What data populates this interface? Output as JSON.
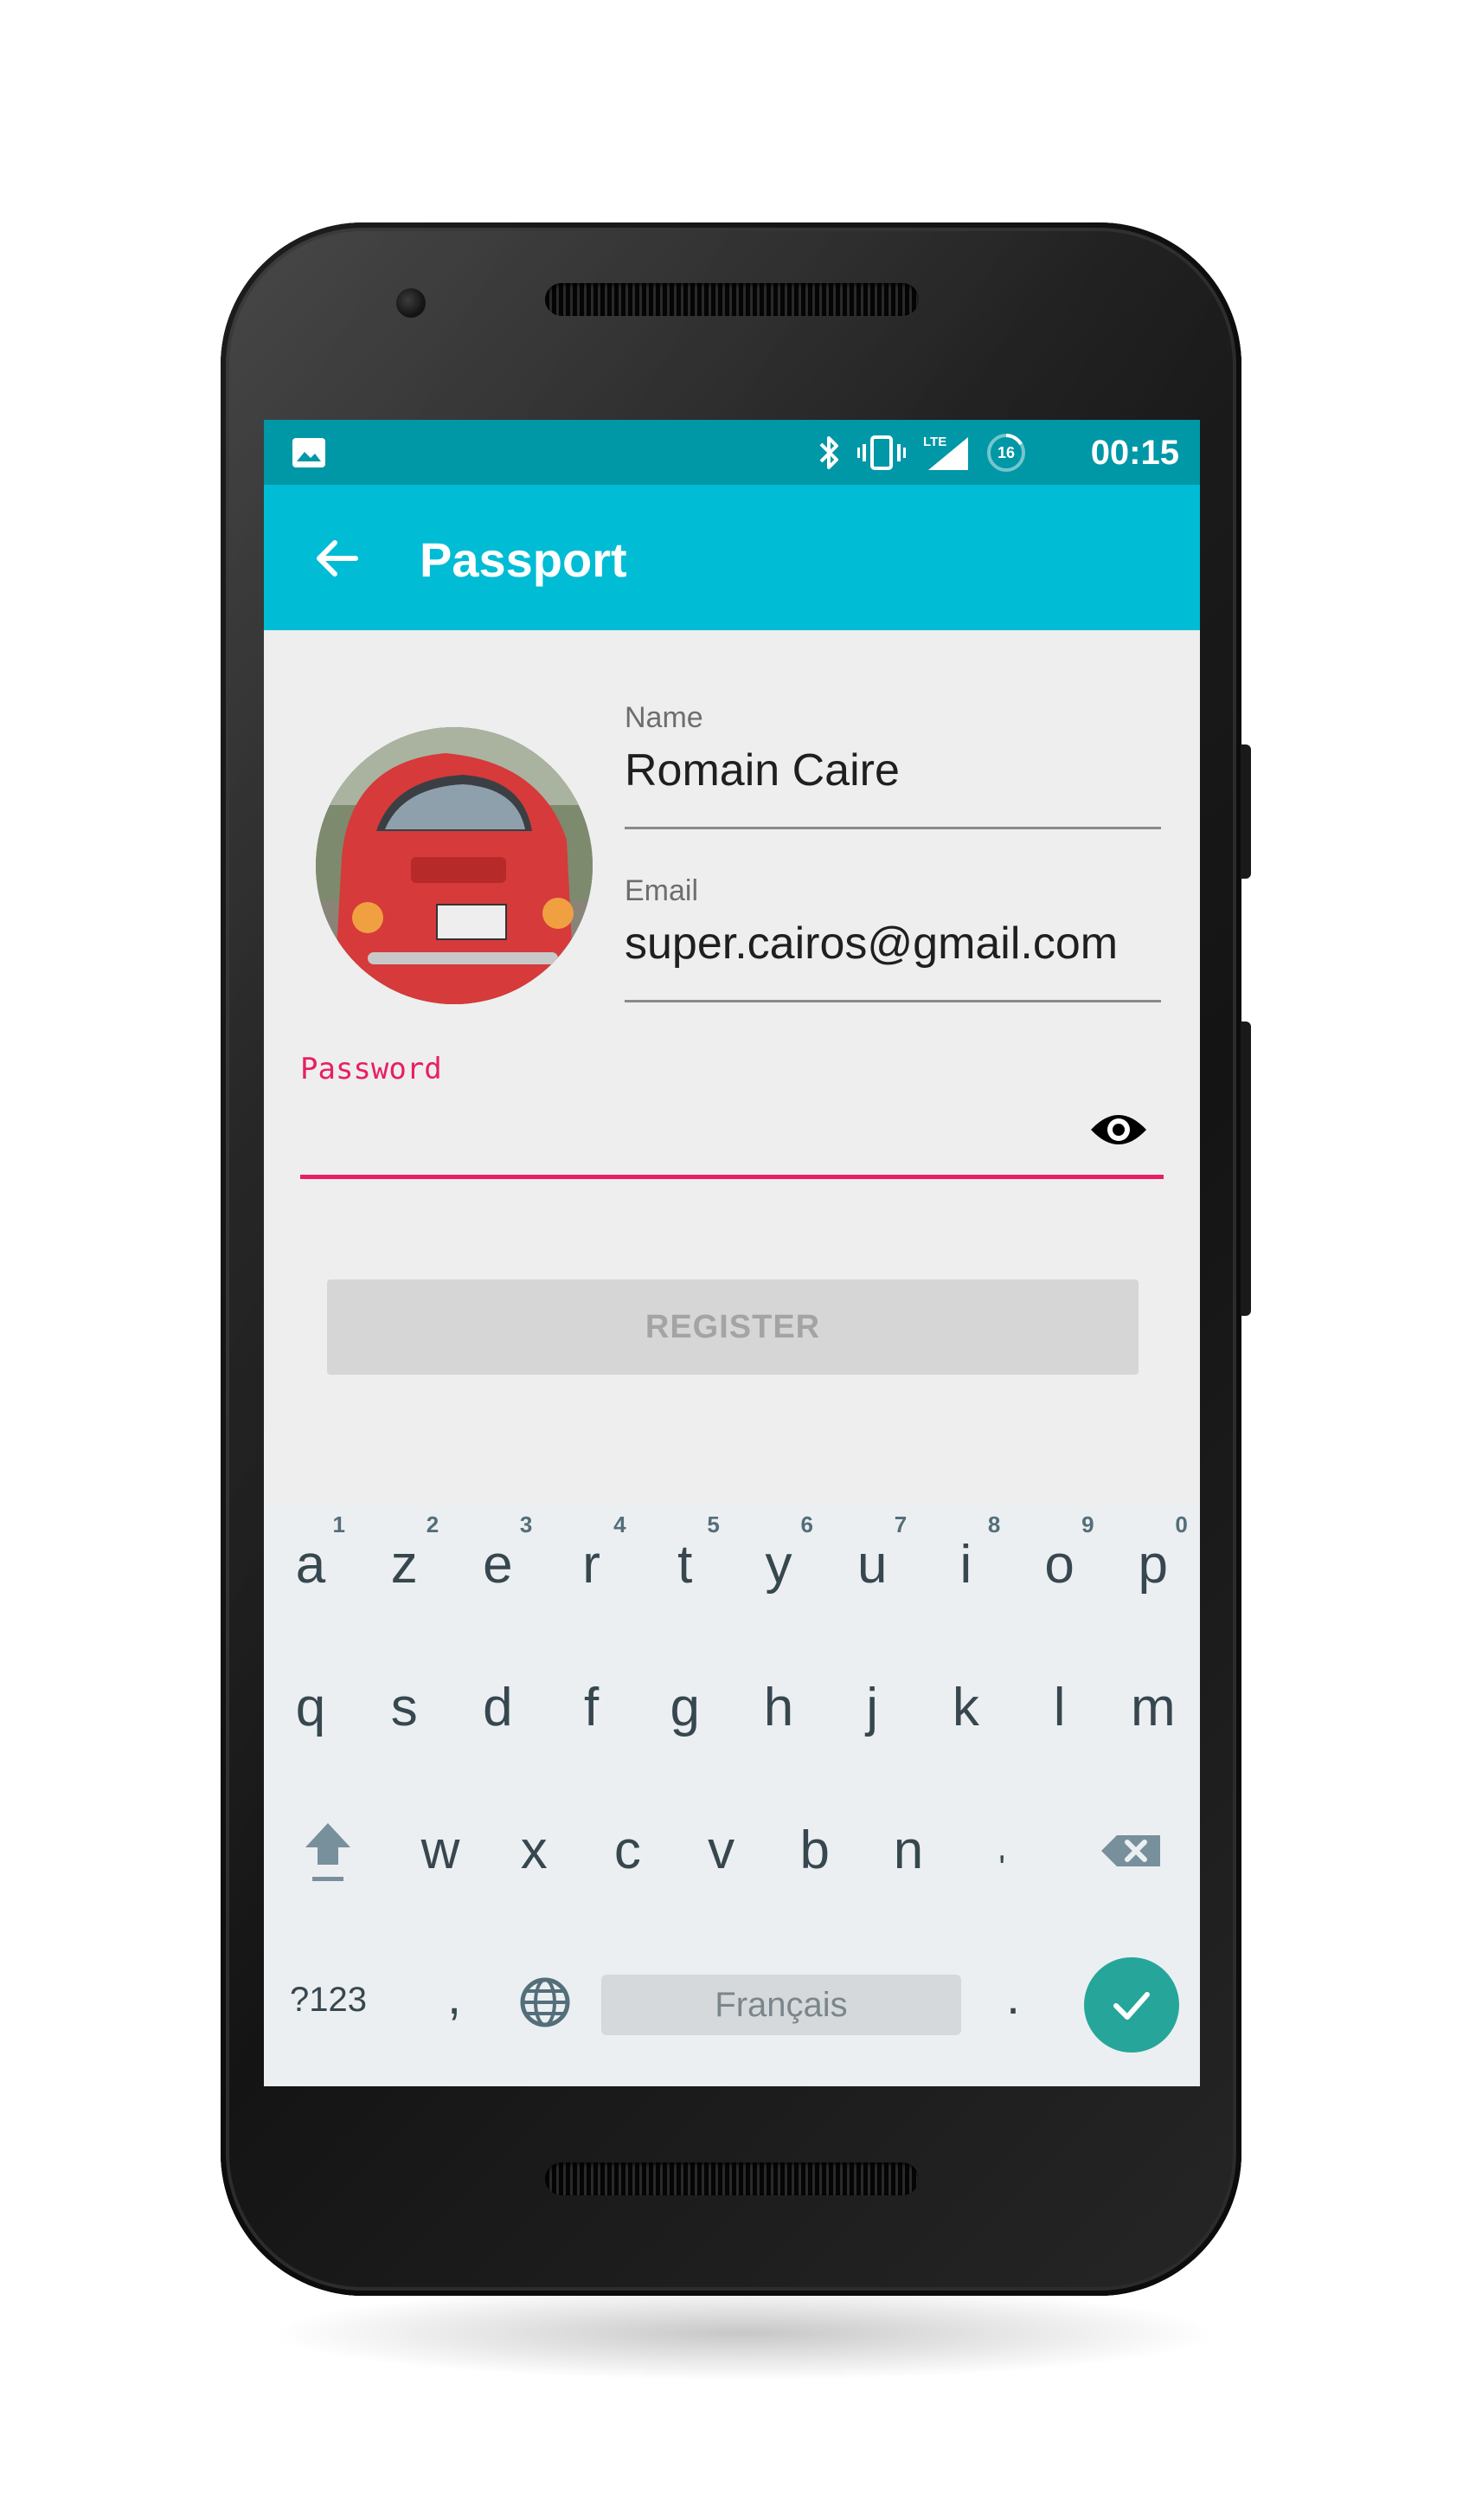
{
  "status_bar": {
    "time": "00:15",
    "battery_percent": "16",
    "network_label": "LTE",
    "icons": [
      "image-icon",
      "bluetooth-icon",
      "vibrate-icon",
      "lte-signal-icon",
      "battery-icon"
    ]
  },
  "app_bar": {
    "title": "Passport",
    "back_icon": "arrow-left-icon"
  },
  "form": {
    "name": {
      "label": "Name",
      "value": "Romain Caire"
    },
    "email": {
      "label": "Email",
      "value": "super.cairos@gmail.com"
    },
    "password": {
      "label": "Password",
      "value": "",
      "toggle_icon": "eye-icon"
    },
    "register_label": "REGISTER"
  },
  "keyboard": {
    "row1": [
      {
        "ch": "a",
        "hint": "1"
      },
      {
        "ch": "z",
        "hint": "2"
      },
      {
        "ch": "e",
        "hint": "3"
      },
      {
        "ch": "r",
        "hint": "4"
      },
      {
        "ch": "t",
        "hint": "5"
      },
      {
        "ch": "y",
        "hint": "6"
      },
      {
        "ch": "u",
        "hint": "7"
      },
      {
        "ch": "i",
        "hint": "8"
      },
      {
        "ch": "o",
        "hint": "9"
      },
      {
        "ch": "p",
        "hint": "0"
      }
    ],
    "row2": [
      "q",
      "s",
      "d",
      "f",
      "g",
      "h",
      "j",
      "k",
      "l",
      "m"
    ],
    "row3": [
      "w",
      "x",
      "c",
      "v",
      "b",
      "n",
      "'"
    ],
    "bottom": {
      "symbols_label": "?123",
      "comma": ",",
      "space_label": "Français",
      "period": "."
    }
  },
  "colors": {
    "status_bar": "#0097a7",
    "app_bar": "#00bcd4",
    "accent": "#e91e63",
    "enter_key": "#26a69a",
    "screen_bg": "#eeeeee"
  }
}
